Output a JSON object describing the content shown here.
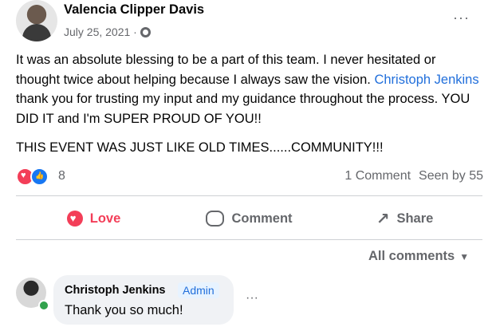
{
  "post": {
    "author": "Valencia Clipper Davis",
    "date": "July 25, 2021 ·",
    "paragraph1_before": "It was an absolute blessing to be a part of this team. I never hesitated or thought twice about helping because I always saw the vision. ",
    "mention": "Christoph Jenkins",
    "paragraph1_after": " thank you for trusting my input and my guidance throughout the process. YOU DID IT and I'm SUPER PROUD OF YOU!!",
    "paragraph2": "THIS EVENT WAS JUST LIKE OLD TIMES......COMMUNITY!!!",
    "reaction_count": "8",
    "comments_stat": "1 Comment",
    "seen_stat": "Seen by 55",
    "more_icon": "···"
  },
  "actions": {
    "love_label": "Love",
    "comment_label": "Comment",
    "share_label": "Share"
  },
  "comments": {
    "filter_label": "All comments",
    "caret": "▼",
    "item": {
      "author": "Christoph Jenkins",
      "badge": "Admin",
      "text": "Thank you so much!",
      "more_icon": "···"
    }
  },
  "colors": {
    "love": "#f33e58",
    "like": "#1877f2",
    "mention": "#216fdb",
    "muted": "#65676b",
    "online": "#31a24c"
  }
}
